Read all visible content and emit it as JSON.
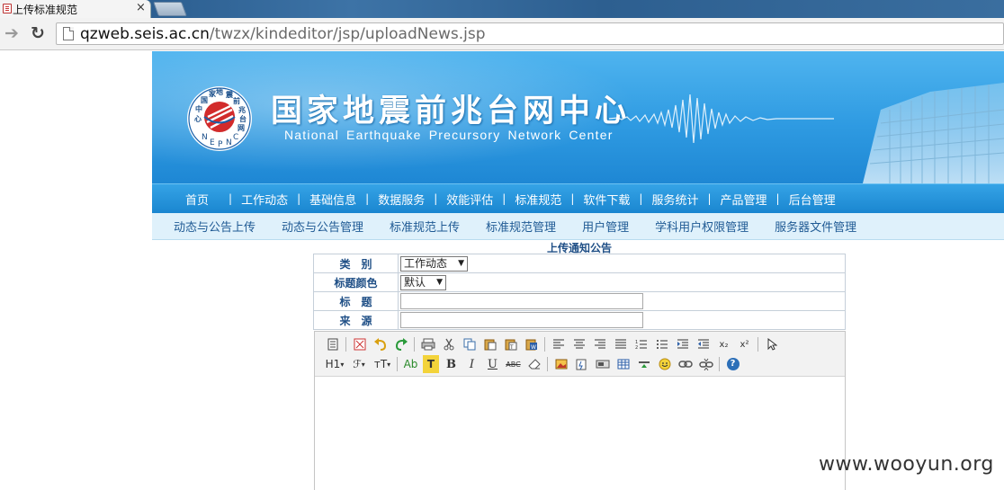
{
  "browser": {
    "tab_title": "上传标准规范",
    "tab_close": "×",
    "url_host": "qzweb.seis.ac.cn",
    "url_path": "/twzx/kindeditor/jsp/uploadNews.jsp"
  },
  "header": {
    "title": "国家地震前兆台网中心",
    "subtitle": "National Earthquake Precursory Network Center",
    "logo_ring_text": "NEPNC",
    "logo_chars": "国家地震前兆台网中心"
  },
  "main_nav": [
    "首页",
    "工作动态",
    "基础信息",
    "数据服务",
    "效能评估",
    "标准规范",
    "软件下载",
    "服务统计",
    "产品管理",
    "后台管理"
  ],
  "sub_nav": [
    "动态与公告上传",
    "动态与公告管理",
    "标准规范上传",
    "标准规范管理",
    "用户管理",
    "学科用户权限管理",
    "服务器文件管理"
  ],
  "form": {
    "title": "上传通知公告",
    "rows": [
      {
        "label": "类　别",
        "type": "select",
        "value": "工作动态"
      },
      {
        "label": "标题颜色",
        "type": "select",
        "value": "默认"
      },
      {
        "label": "标　题",
        "type": "text",
        "value": ""
      },
      {
        "label": "来　源",
        "type": "text",
        "value": ""
      }
    ]
  },
  "editor": {
    "row2_text": {
      "heading": "H1",
      "font": "ℱ",
      "size": "тT",
      "forecolor": "Ab",
      "hilite": "T",
      "bold": "B",
      "italic": "I",
      "underline": "U",
      "strike": "ABC"
    },
    "icons_row1": [
      "source-icon",
      "fullscreen-icon",
      "undo-icon",
      "redo-icon",
      "print-icon",
      "cut-icon",
      "copy-icon",
      "paste-icon",
      "paste-plain-icon",
      "paste-word-icon",
      "align-left-icon",
      "align-center-icon",
      "align-right-icon",
      "justify-icon",
      "ordered-list-icon",
      "unordered-list-icon",
      "indent-icon",
      "outdent-icon",
      "subscript-icon",
      "superscript-icon",
      "select-all-icon"
    ],
    "icons_row2": [
      "image-icon",
      "flash-icon",
      "media-icon",
      "table-icon",
      "hr-icon",
      "emoticon-icon",
      "link-icon",
      "unlink-icon",
      "help-icon"
    ],
    "subscript": "x₂",
    "superscript": "x²",
    "help": "?"
  },
  "watermark": "www.wooyun.org",
  "colors": {
    "banner": "#2f9be2",
    "nav": "#1a86d0",
    "subnav_bg": "#dff1fb",
    "label": "#1f4f86"
  }
}
